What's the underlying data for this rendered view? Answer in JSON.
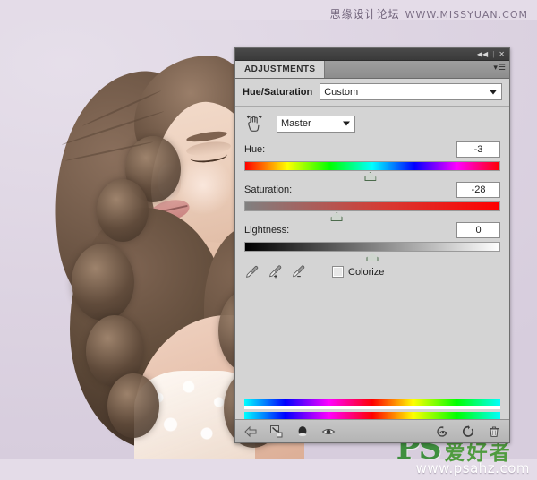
{
  "watermarks": {
    "top_cn": "思缘设计论坛",
    "top_url": "WWW.MISSYUAN.COM",
    "logo_ps": "PS",
    "logo_cn": "爱好者",
    "logo_url": "www.psahz.com"
  },
  "photo": {
    "alt": "portrait of woman with curly brown hair on lavender background",
    "background_color": "#ddd2e2"
  },
  "panel": {
    "titlebar": {
      "collapse_icon": "collapse-double-arrow",
      "collapse_glyph": "◀◀",
      "separator": "|",
      "close_icon": "close-icon",
      "close_glyph": "✕"
    },
    "tab_label": "ADJUSTMENTS",
    "menu_icon": "panel-menu-icon",
    "menu_glyph": "▾",
    "menu_bars": "☰",
    "adjustment_title": "Hue/Saturation",
    "preset": {
      "value": "Custom",
      "placeholder": "Custom"
    },
    "targeted_adjust_icon": "on-image-adjustment-hand-icon",
    "channel": {
      "value": "Master"
    },
    "sliders": [
      {
        "name": "hue",
        "label": "Hue:",
        "value": "-3",
        "min": -180,
        "max": 180,
        "numeric": -3,
        "percent": 49.2,
        "track": "hue-spectrum"
      },
      {
        "name": "saturation",
        "label": "Saturation:",
        "value": "-28",
        "min": -100,
        "max": 100,
        "numeric": -28,
        "percent": 36,
        "track": "gray-to-red"
      },
      {
        "name": "lightness",
        "label": "Lightness:",
        "value": "0",
        "min": -100,
        "max": 100,
        "numeric": 0,
        "percent": 50,
        "track": "black-to-white"
      }
    ],
    "eyedroppers": [
      {
        "name": "eyedropper-sample",
        "title": "Sample color"
      },
      {
        "name": "eyedropper-add",
        "title": "Add to sample"
      },
      {
        "name": "eyedropper-subtract",
        "title": "Subtract from sample"
      }
    ],
    "colorize": {
      "label": "Colorize",
      "checked": false
    },
    "footer_icons": [
      {
        "name": "return-to-adjustment-list-icon"
      },
      {
        "name": "clip-to-layer-icon"
      },
      {
        "name": "black-white-preset-icon"
      },
      {
        "name": "toggle-layer-visibility-icon"
      },
      {
        "name": "view-previous-state-icon"
      },
      {
        "name": "reset-adjustment-icon"
      },
      {
        "name": "delete-adjustment-layer-icon"
      }
    ]
  },
  "colors": {
    "panel_bg": "#d4d4d4",
    "panel_border": "#6e6e6e",
    "titlebar": "#3f3f3f",
    "tab_strip": "#949494",
    "slider_thumb": "#cfd6cf",
    "logo_green": "#3f8f3f"
  }
}
